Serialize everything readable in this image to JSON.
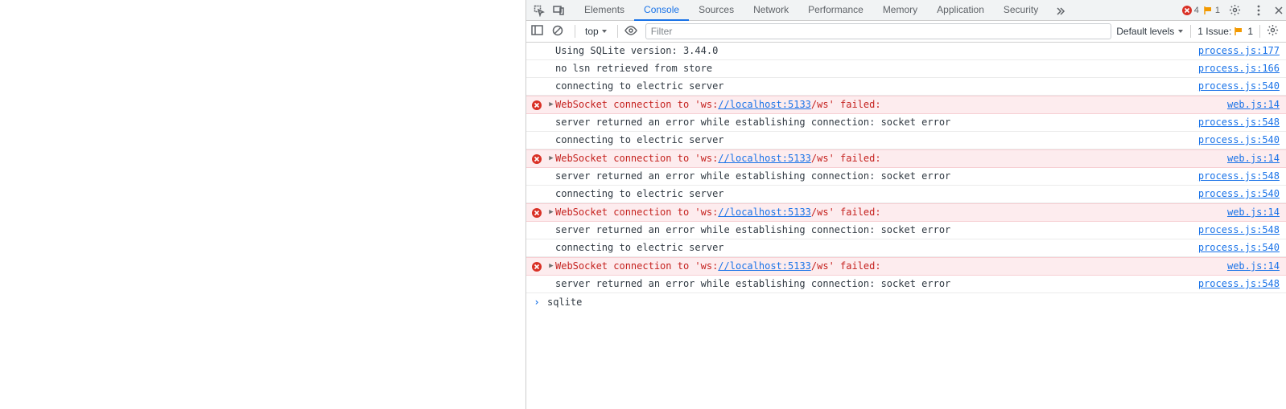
{
  "tabs": [
    "Elements",
    "Console",
    "Sources",
    "Network",
    "Performance",
    "Memory",
    "Application",
    "Security"
  ],
  "active_tab_index": 1,
  "status": {
    "errors": 4,
    "issues": 1
  },
  "toolbar": {
    "context": "top",
    "filter_placeholder": "Filter",
    "levels_label": "Default levels",
    "issues_label": "1 Issue:",
    "issues_count": 1
  },
  "ws_url_text": "//localhost:5133",
  "messages": [
    {
      "type": "log",
      "text": "Using SQLite version: 3.44.0",
      "src": "process.js:177"
    },
    {
      "type": "log",
      "text": "no lsn retrieved from store",
      "src": "process.js:166"
    },
    {
      "type": "log",
      "text": "connecting to electric server",
      "src": "process.js:540"
    },
    {
      "type": "error",
      "pre": "WebSocket connection to 'ws:",
      "url": "//localhost:5133",
      "post": "/ws' failed:",
      "src": "web.js:14"
    },
    {
      "type": "log",
      "text": "server returned an error while establishing connection: socket error",
      "src": "process.js:548"
    },
    {
      "type": "log",
      "text": "connecting to electric server",
      "src": "process.js:540"
    },
    {
      "type": "error",
      "pre": "WebSocket connection to 'ws:",
      "url": "//localhost:5133",
      "post": "/ws' failed:",
      "src": "web.js:14"
    },
    {
      "type": "log",
      "text": "server returned an error while establishing connection: socket error",
      "src": "process.js:548"
    },
    {
      "type": "log",
      "text": "connecting to electric server",
      "src": "process.js:540"
    },
    {
      "type": "error",
      "pre": "WebSocket connection to 'ws:",
      "url": "//localhost:5133",
      "post": "/ws' failed:",
      "src": "web.js:14"
    },
    {
      "type": "log",
      "text": "server returned an error while establishing connection: socket error",
      "src": "process.js:548"
    },
    {
      "type": "log",
      "text": "connecting to electric server",
      "src": "process.js:540"
    },
    {
      "type": "error",
      "pre": "WebSocket connection to 'ws:",
      "url": "//localhost:5133",
      "post": "/ws' failed:",
      "src": "web.js:14"
    },
    {
      "type": "log",
      "text": "server returned an error while establishing connection: socket error",
      "src": "process.js:548"
    }
  ],
  "prompt_text": "sqlite"
}
